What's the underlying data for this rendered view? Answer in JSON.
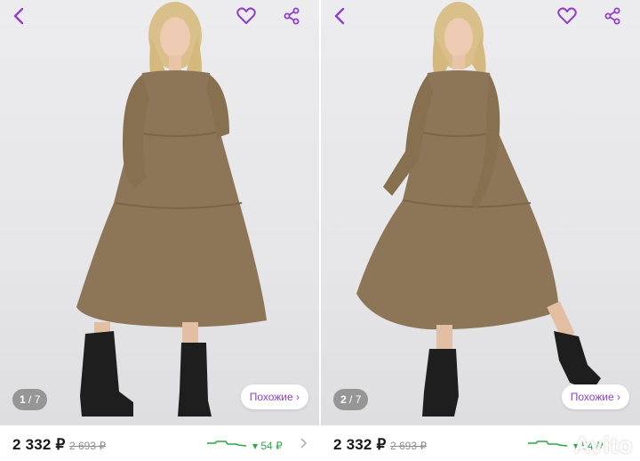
{
  "colors": {
    "accent": "#8f3fc9",
    "price_drop": "#2fa64a",
    "dress": "#8d7557"
  },
  "icons": [
    "back-arrow-icon",
    "heart-icon",
    "share-icon",
    "chevron-right-icon"
  ],
  "cards": [
    {
      "counter_current": "1",
      "counter_sep": " / 7",
      "similar": "Похожие ›",
      "price": "2 332 ₽",
      "old_price": "2 693 ₽",
      "drop": "▾ 54 ₽"
    },
    {
      "counter_current": "2",
      "counter_sep": " / 7",
      "similar": "Похожие ›",
      "price": "2 332 ₽",
      "old_price": "2 693 ₽",
      "drop": "▾ 54 ₽",
      "watermark": "Avito"
    }
  ]
}
